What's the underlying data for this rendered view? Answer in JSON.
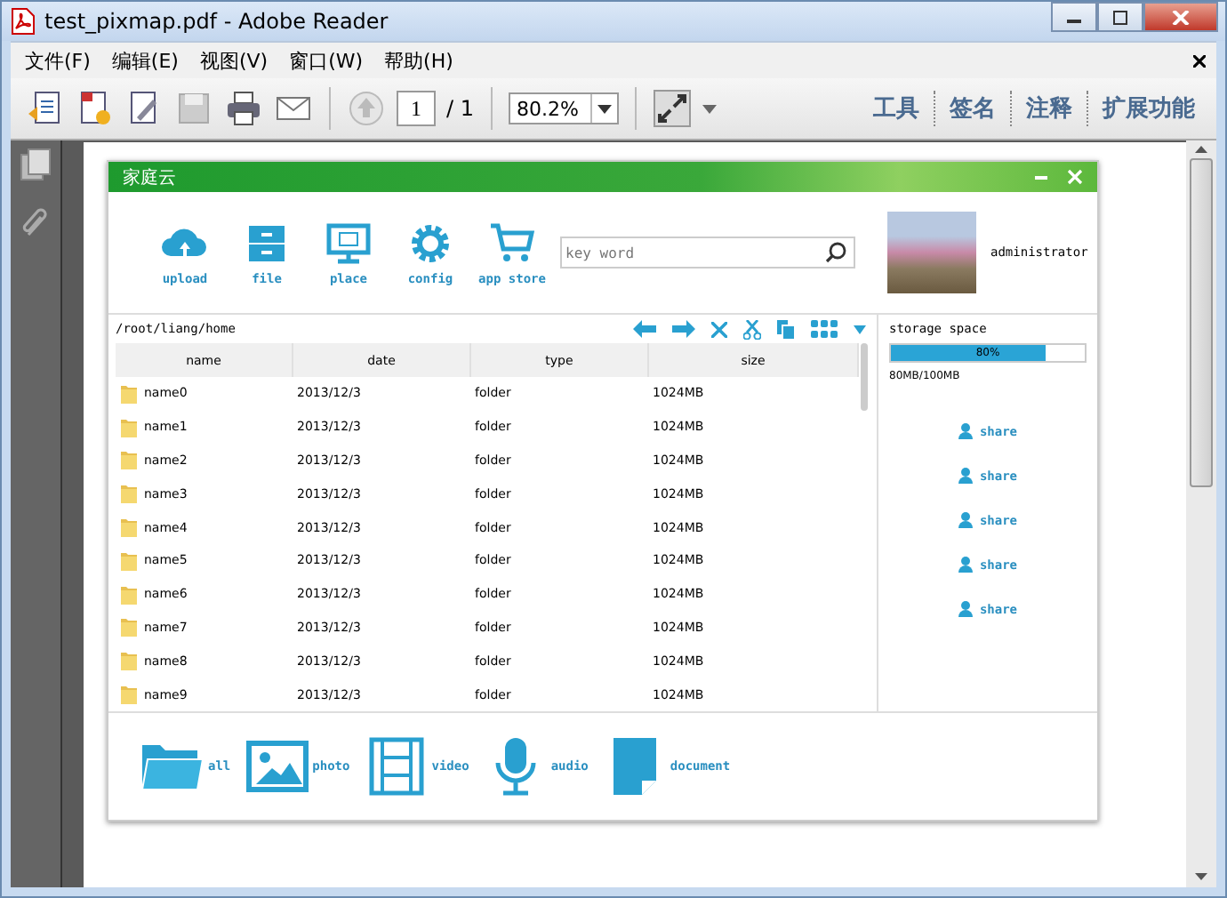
{
  "window": {
    "title": "test_pixmap.pdf - Adobe Reader"
  },
  "menu": [
    "文件(F)",
    "编辑(E)",
    "视图(V)",
    "窗口(W)",
    "帮助(H)"
  ],
  "toolbar": {
    "page": "1",
    "page_total": "/ 1",
    "zoom": "80.2%",
    "panels": [
      "工具",
      "签名",
      "注释",
      "扩展功能"
    ]
  },
  "app": {
    "title": "家庭云",
    "nav": [
      {
        "kind": "upload",
        "label": "upload"
      },
      {
        "kind": "file",
        "label": "file"
      },
      {
        "kind": "place",
        "label": "place"
      },
      {
        "kind": "config",
        "label": "config"
      },
      {
        "kind": "store",
        "label": "app store"
      }
    ],
    "search": {
      "placeholder": "key word"
    },
    "user": {
      "name": "administrator"
    },
    "path": "/root/liang/home",
    "table": {
      "columns": [
        "name",
        "date",
        "type",
        "size"
      ],
      "rows": [
        [
          "name0",
          "2013/12/3",
          "folder",
          "1024MB"
        ],
        [
          "name1",
          "2013/12/3",
          "folder",
          "1024MB"
        ],
        [
          "name2",
          "2013/12/3",
          "folder",
          "1024MB"
        ],
        [
          "name3",
          "2013/12/3",
          "folder",
          "1024MB"
        ],
        [
          "name4",
          "2013/12/3",
          "folder",
          "1024MB"
        ],
        [
          "name5",
          "2013/12/3",
          "folder",
          "1024MB"
        ],
        [
          "name6",
          "2013/12/3",
          "folder",
          "1024MB"
        ],
        [
          "name7",
          "2013/12/3",
          "folder",
          "1024MB"
        ],
        [
          "name8",
          "2013/12/3",
          "folder",
          "1024MB"
        ],
        [
          "name9",
          "2013/12/3",
          "folder",
          "1024MB"
        ]
      ]
    },
    "storage": {
      "label": "storage space",
      "level": 0.8,
      "percent": "80%",
      "reading": "80MB/100MB"
    },
    "shares": [
      "share",
      "share",
      "share",
      "share",
      "share"
    ],
    "categories": [
      {
        "kind": "all",
        "label": "all"
      },
      {
        "kind": "photo",
        "label": "photo"
      },
      {
        "kind": "video",
        "label": "video"
      },
      {
        "kind": "audio",
        "label": "audio"
      },
      {
        "kind": "document",
        "label": "document"
      }
    ]
  }
}
